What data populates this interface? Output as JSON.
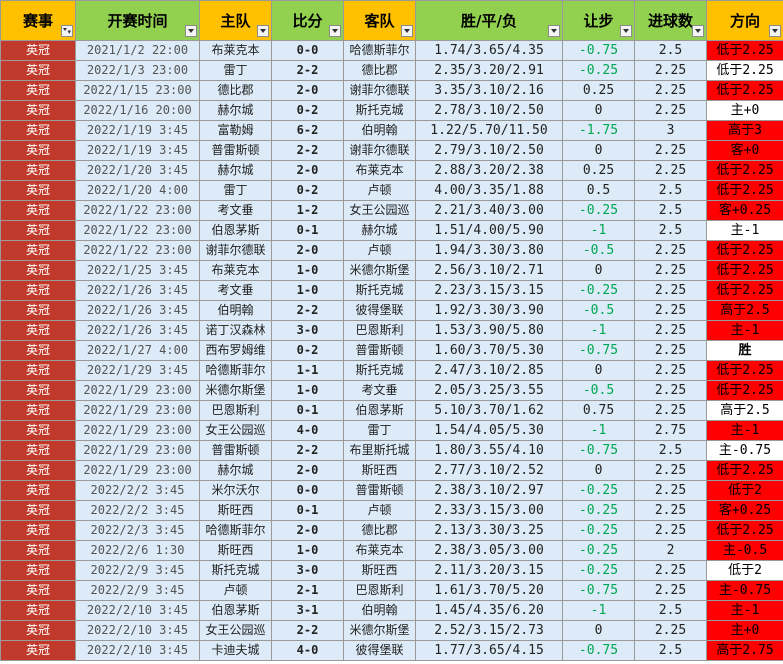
{
  "header": {
    "league": "赛事",
    "time": "开赛时间",
    "home": "主队",
    "score": "比分",
    "away": "客队",
    "odds": "胜/平/负",
    "handicap": "让步",
    "goals": "进球数",
    "direction": "方向"
  },
  "colors": {
    "header_bg": "#ffc000",
    "header_green": "#92d050",
    "league_cell": "#c0392b",
    "row_bg": "#dcebf7",
    "direction_red": "#ff0000",
    "handicap_negative": "#00a651"
  },
  "icons": {
    "filter": "filter-dropdown-icon",
    "filter_active": "filter-active-icon"
  },
  "rows": [
    {
      "league": "英冠",
      "time": "2021/1/2 22:00",
      "home": "布莱克本",
      "score": "0-0",
      "away": "哈德斯菲尔",
      "odds": "1.74/3.65/4.35",
      "handicap": "-0.75",
      "goals": "2.5",
      "direction": "低于2.25",
      "dir_style": "red"
    },
    {
      "league": "英冠",
      "time": "2022/1/3 23:00",
      "home": "雷丁",
      "score": "2-2",
      "away": "德比郡",
      "odds": "2.35/3.20/2.91",
      "handicap": "-0.25",
      "goals": "2.25",
      "direction": "低于2.25",
      "dir_style": "white"
    },
    {
      "league": "英冠",
      "time": "2022/1/15 23:00",
      "home": "德比郡",
      "score": "2-0",
      "away": "谢菲尔德联",
      "odds": "3.35/3.10/2.16",
      "handicap": "0.25",
      "goals": "2.25",
      "direction": "低于2.25",
      "dir_style": "red"
    },
    {
      "league": "英冠",
      "time": "2022/1/16 20:00",
      "home": "赫尔城",
      "score": "0-2",
      "away": "斯托克城",
      "odds": "2.78/3.10/2.50",
      "handicap": "0",
      "goals": "2.25",
      "direction": "主+0",
      "dir_style": "white"
    },
    {
      "league": "英冠",
      "time": "2022/1/19 3:45",
      "home": "富勒姆",
      "score": "6-2",
      "away": "伯明翰",
      "odds": "1.22/5.70/11.50",
      "handicap": "-1.75",
      "goals": "3",
      "direction": "高于3",
      "dir_style": "red"
    },
    {
      "league": "英冠",
      "time": "2022/1/19 3:45",
      "home": "普雷斯顿",
      "score": "2-2",
      "away": "谢菲尔德联",
      "odds": "2.79/3.10/2.50",
      "handicap": "0",
      "goals": "2.25",
      "direction": "客+0",
      "dir_style": "red"
    },
    {
      "league": "英冠",
      "time": "2022/1/20 3:45",
      "home": "赫尔城",
      "score": "2-0",
      "away": "布莱克本",
      "odds": "2.88/3.20/2.38",
      "handicap": "0.25",
      "goals": "2.25",
      "direction": "低于2.25",
      "dir_style": "red"
    },
    {
      "league": "英冠",
      "time": "2022/1/20 4:00",
      "home": "雷丁",
      "score": "0-2",
      "away": "卢顿",
      "odds": "4.00/3.35/1.88",
      "handicap": "0.5",
      "goals": "2.5",
      "direction": "低于2.25",
      "dir_style": "red"
    },
    {
      "league": "英冠",
      "time": "2022/1/22 23:00",
      "home": "考文垂",
      "score": "1-2",
      "away": "女王公园巡",
      "odds": "2.21/3.40/3.00",
      "handicap": "-0.25",
      "goals": "2.5",
      "direction": "客+0.25",
      "dir_style": "red"
    },
    {
      "league": "英冠",
      "time": "2022/1/22 23:00",
      "home": "伯恩茅斯",
      "score": "0-1",
      "away": "赫尔城",
      "odds": "1.51/4.00/5.90",
      "handicap": "-1",
      "goals": "2.5",
      "direction": "主-1",
      "dir_style": "white"
    },
    {
      "league": "英冠",
      "time": "2022/1/22 23:00",
      "home": "谢菲尔德联",
      "score": "2-0",
      "away": "卢顿",
      "odds": "1.94/3.30/3.80",
      "handicap": "-0.5",
      "goals": "2.25",
      "direction": "低于2.25",
      "dir_style": "red"
    },
    {
      "league": "英冠",
      "time": "2022/1/25 3:45",
      "home": "布莱克本",
      "score": "1-0",
      "away": "米德尔斯堡",
      "odds": "2.56/3.10/2.71",
      "handicap": "0",
      "goals": "2.25",
      "direction": "低于2.25",
      "dir_style": "red"
    },
    {
      "league": "英冠",
      "time": "2022/1/26 3:45",
      "home": "考文垂",
      "score": "1-0",
      "away": "斯托克城",
      "odds": "2.23/3.15/3.15",
      "handicap": "-0.25",
      "goals": "2.25",
      "direction": "低于2.25",
      "dir_style": "red"
    },
    {
      "league": "英冠",
      "time": "2022/1/26 3:45",
      "home": "伯明翰",
      "score": "2-2",
      "away": "彼得堡联",
      "odds": "1.92/3.30/3.90",
      "handicap": "-0.5",
      "goals": "2.25",
      "direction": "高于2.5",
      "dir_style": "red"
    },
    {
      "league": "英冠",
      "time": "2022/1/26 3:45",
      "home": "诺丁汉森林",
      "score": "3-0",
      "away": "巴恩斯利",
      "odds": "1.53/3.90/5.80",
      "handicap": "-1",
      "goals": "2.25",
      "direction": "主-1",
      "dir_style": "red"
    },
    {
      "league": "英冠",
      "time": "2022/1/27 4:00",
      "home": "西布罗姆维",
      "score": "0-2",
      "away": "普雷斯顿",
      "odds": "1.60/3.70/5.30",
      "handicap": "-0.75",
      "goals": "2.25",
      "direction": "胜",
      "dir_style": "white-bold"
    },
    {
      "league": "英冠",
      "time": "2022/1/29 3:45",
      "home": "哈德斯菲尔",
      "score": "1-1",
      "away": "斯托克城",
      "odds": "2.47/3.10/2.85",
      "handicap": "0",
      "goals": "2.25",
      "direction": "低于2.25",
      "dir_style": "red"
    },
    {
      "league": "英冠",
      "time": "2022/1/29 23:00",
      "home": "米德尔斯堡",
      "score": "1-0",
      "away": "考文垂",
      "odds": "2.05/3.25/3.55",
      "handicap": "-0.5",
      "goals": "2.25",
      "direction": "低于2.25",
      "dir_style": "red"
    },
    {
      "league": "英冠",
      "time": "2022/1/29 23:00",
      "home": "巴恩斯利",
      "score": "0-1",
      "away": "伯恩茅斯",
      "odds": "5.10/3.70/1.62",
      "handicap": "0.75",
      "goals": "2.25",
      "direction": "高于2.5",
      "dir_style": "white"
    },
    {
      "league": "英冠",
      "time": "2022/1/29 23:00",
      "home": "女王公园巡",
      "score": "4-0",
      "away": "雷丁",
      "odds": "1.54/4.05/5.30",
      "handicap": "-1",
      "goals": "2.75",
      "direction": "主-1",
      "dir_style": "red"
    },
    {
      "league": "英冠",
      "time": "2022/1/29 23:00",
      "home": "普雷斯顿",
      "score": "2-2",
      "away": "布里斯托城",
      "odds": "1.80/3.55/4.10",
      "handicap": "-0.75",
      "goals": "2.5",
      "direction": "主-0.75",
      "dir_style": "white"
    },
    {
      "league": "英冠",
      "time": "2022/1/29 23:00",
      "home": "赫尔城",
      "score": "2-0",
      "away": "斯旺西",
      "odds": "2.77/3.10/2.52",
      "handicap": "0",
      "goals": "2.25",
      "direction": "低于2.25",
      "dir_style": "red"
    },
    {
      "league": "英冠",
      "time": "2022/2/2 3:45",
      "home": "米尔沃尔",
      "score": "0-0",
      "away": "普雷斯顿",
      "odds": "2.38/3.10/2.97",
      "handicap": "-0.25",
      "goals": "2.25",
      "direction": "低于2",
      "dir_style": "red"
    },
    {
      "league": "英冠",
      "time": "2022/2/2 3:45",
      "home": "斯旺西",
      "score": "0-1",
      "away": "卢顿",
      "odds": "2.33/3.15/3.00",
      "handicap": "-0.25",
      "goals": "2.25",
      "direction": "客+0.25",
      "dir_style": "red"
    },
    {
      "league": "英冠",
      "time": "2022/2/3 3:45",
      "home": "哈德斯菲尔",
      "score": "2-0",
      "away": "德比郡",
      "odds": "2.13/3.30/3.25",
      "handicap": "-0.25",
      "goals": "2.25",
      "direction": "低于2.25",
      "dir_style": "red"
    },
    {
      "league": "英冠",
      "time": "2022/2/6 1:30",
      "home": "斯旺西",
      "score": "1-0",
      "away": "布莱克本",
      "odds": "2.38/3.05/3.00",
      "handicap": "-0.25",
      "goals": "2",
      "direction": "主-0.5",
      "dir_style": "red"
    },
    {
      "league": "英冠",
      "time": "2022/2/9 3:45",
      "home": "斯托克城",
      "score": "3-0",
      "away": "斯旺西",
      "odds": "2.11/3.20/3.15",
      "handicap": "-0.25",
      "goals": "2.25",
      "direction": "低于2",
      "dir_style": "white"
    },
    {
      "league": "英冠",
      "time": "2022/2/9 3:45",
      "home": "卢顿",
      "score": "2-1",
      "away": "巴恩斯利",
      "odds": "1.61/3.70/5.20",
      "handicap": "-0.75",
      "goals": "2.25",
      "direction": "主-0.75",
      "dir_style": "red"
    },
    {
      "league": "英冠",
      "time": "2022/2/10 3:45",
      "home": "伯恩茅斯",
      "score": "3-1",
      "away": "伯明翰",
      "odds": "1.45/4.35/6.20",
      "handicap": "-1",
      "goals": "2.5",
      "direction": "主-1",
      "dir_style": "red"
    },
    {
      "league": "英冠",
      "time": "2022/2/10 3:45",
      "home": "女王公园巡",
      "score": "2-2",
      "away": "米德尔斯堡",
      "odds": "2.52/3.15/2.73",
      "handicap": "0",
      "goals": "2.25",
      "direction": "主+0",
      "dir_style": "red"
    },
    {
      "league": "英冠",
      "time": "2022/2/10 3:45",
      "home": "卡迪夫城",
      "score": "4-0",
      "away": "彼得堡联",
      "odds": "1.77/3.65/4.15",
      "handicap": "-0.75",
      "goals": "2.5",
      "direction": "高于2.75",
      "dir_style": "red"
    }
  ]
}
